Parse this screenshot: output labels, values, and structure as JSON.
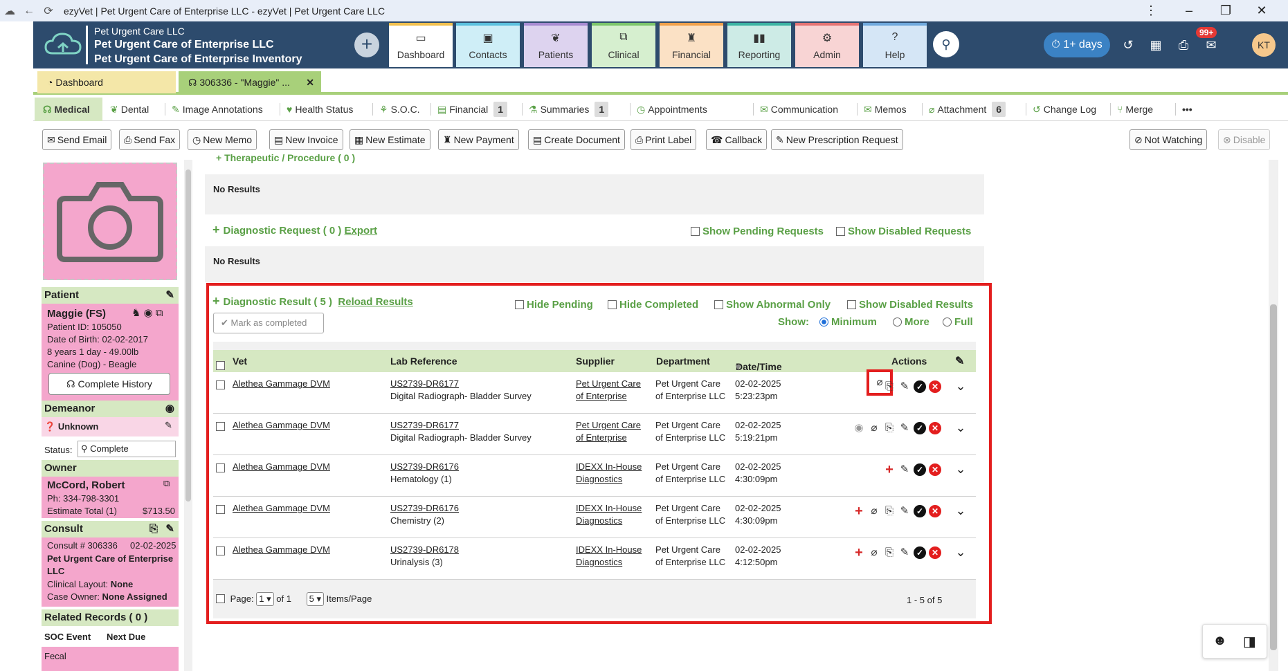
{
  "window": {
    "title": "ezyVet | Pet Urgent Care of Enterprise LLC - ezyVet | Pet Urgent Care LLC"
  },
  "header": {
    "org_line1": "Pet Urgent Care LLC",
    "org_line2": "Pet Urgent Care of Enterprise LLC",
    "org_line3": "Pet Urgent Care of Enterprise Inventory",
    "modules": [
      {
        "label": "Dashboard",
        "color": "#f2c04e",
        "bg": "#ffffff"
      },
      {
        "label": "Contacts",
        "color": "#5bc0de",
        "bg": "#cfeef7"
      },
      {
        "label": "Patients",
        "color": "#a78bd1",
        "bg": "#ddd3ef"
      },
      {
        "label": "Clinical",
        "color": "#7cc56b",
        "bg": "#d6efcf"
      },
      {
        "label": "Financial",
        "color": "#f0a04b",
        "bg": "#fbe1c5"
      },
      {
        "label": "Reporting",
        "color": "#3bb3a3",
        "bg": "#cdebe6"
      },
      {
        "label": "Admin",
        "color": "#e57373",
        "bg": "#f8d4d4"
      },
      {
        "label": "Help",
        "color": "#6fa8dc",
        "bg": "#d5e6f6"
      }
    ],
    "timer": "1+ days",
    "notifications_badge": "99+",
    "user_initials": "KT"
  },
  "tabs": {
    "dashboard": "Dashboard",
    "record": "306336 - \"Maggie\" ..."
  },
  "subnav": {
    "medical": "Medical",
    "dental": "Dental",
    "image_annotations": "Image Annotations",
    "health_status": "Health Status",
    "soc": "S.O.C.",
    "financial": "Financial",
    "financial_count": "1",
    "summaries": "Summaries",
    "summaries_count": "1",
    "appointments": "Appointments",
    "communication": "Communication",
    "memos": "Memos",
    "attachment": "Attachment",
    "attachment_count": "6",
    "change_log": "Change Log",
    "merge": "Merge",
    "more": "•••"
  },
  "toolbar": {
    "send_email": "Send Email",
    "send_fax": "Send Fax",
    "new_memo": "New Memo",
    "new_invoice": "New Invoice",
    "new_estimate": "New Estimate",
    "new_payment": "New Payment",
    "create_document": "Create Document",
    "print_label": "Print Label",
    "callback": "Callback",
    "new_prescription_request": "New Prescription Request",
    "not_watching": "Not Watching",
    "disable": "Disable"
  },
  "patient": {
    "section": "Patient",
    "name": "Maggie (FS)",
    "id": "Patient ID: 105050",
    "dob": "Date of Birth: 02-02-2017",
    "age_weight": "8 years 1 day - 49.00lb",
    "species": "Canine (Dog) - Beagle",
    "complete_history": "Complete History",
    "demeanor_section": "Demeanor",
    "demeanor": "Unknown",
    "status_label": "Status:",
    "status_value": "Complete",
    "owner_section": "Owner",
    "owner_name": "McCord, Robert",
    "owner_phone": "Ph: 334-798-3301",
    "estimate_label": "Estimate Total (1)",
    "estimate_value": "$713.50",
    "consult_section": "Consult",
    "consult_number": "Consult # 306336",
    "consult_date": "02-02-2025",
    "consult_clinic": "Pet Urgent Care of Enterprise LLC",
    "clinical_layout_label": "Clinical Layout:",
    "clinical_layout_value": "None",
    "case_owner_label": "Case Owner:",
    "case_owner_value": "None Assigned",
    "related_records": "Related Records ( 0 )",
    "soc_event": "SOC Event",
    "next_due": "Next Due",
    "fecal": "Fecal"
  },
  "main": {
    "therapeutic_header": "Therapeutic / Procedure ( 0 )",
    "no_results_1": "No Results",
    "diag_request_title": "Diagnostic Request ( 0 )",
    "diag_request_export": "Export",
    "show_pending_requests": "Show Pending Requests",
    "show_disabled_requests": "Show Disabled Requests",
    "no_results_2": "No Results",
    "diag_result_title": "Diagnostic Result ( 5 )",
    "reload_results": "Reload Results",
    "hide_pending": "Hide Pending",
    "hide_completed": "Hide Completed",
    "show_abnormal_only": "Show Abnormal Only",
    "show_disabled_results": "Show Disabled Results",
    "show_label": "Show:",
    "show_minimum": "Minimum",
    "show_more": "More",
    "show_full": "Full",
    "mark_as_completed": "Mark as completed",
    "columns": {
      "vet": "Vet",
      "lab_reference": "Lab Reference",
      "supplier": "Supplier",
      "department": "Department",
      "datetime": "Date/Time",
      "actions": "Actions"
    },
    "rows": [
      {
        "vet": "Alethea Gammage DVM",
        "lab_ref": "US2739-DR6177",
        "test": "Digital Radiograph- Bladder Survey",
        "supplier1": "Pet Urgent Care",
        "supplier2": "of Enterprise",
        "dept1": "Pet Urgent Care",
        "dept2": "of Enterprise LLC",
        "date": "02-02-2025",
        "time": "5:23:23pm"
      },
      {
        "vet": "Alethea Gammage DVM",
        "lab_ref": "US2739-DR6177",
        "test": "Digital Radiograph- Bladder Survey",
        "supplier1": "Pet Urgent Care",
        "supplier2": "of Enterprise",
        "dept1": "Pet Urgent Care",
        "dept2": "of Enterprise LLC",
        "date": "02-02-2025",
        "time": "5:19:21pm"
      },
      {
        "vet": "Alethea Gammage DVM",
        "lab_ref": "US2739-DR6176",
        "test": "Hematology (1)",
        "supplier1": "IDEXX In-House",
        "supplier2": "Diagnostics",
        "dept1": "Pet Urgent Care",
        "dept2": "of Enterprise LLC",
        "date": "02-02-2025",
        "time": "4:30:09pm"
      },
      {
        "vet": "Alethea Gammage DVM",
        "lab_ref": "US2739-DR6176",
        "test": "Chemistry (2)",
        "supplier1": "IDEXX In-House",
        "supplier2": "Diagnostics",
        "dept1": "Pet Urgent Care",
        "dept2": "of Enterprise LLC",
        "date": "02-02-2025",
        "time": "4:30:09pm"
      },
      {
        "vet": "Alethea Gammage DVM",
        "lab_ref": "US2739-DR6178",
        "test": "Urinalysis (3)",
        "supplier1": "IDEXX In-House",
        "supplier2": "Diagnostics",
        "dept1": "Pet Urgent Care",
        "dept2": "of Enterprise LLC",
        "date": "02-02-2025",
        "time": "4:12:50pm"
      }
    ],
    "page_label": "Page:",
    "page_value": "1",
    "of_total": "of 1",
    "items_per_page_value": "5",
    "items_per_page_label": "Items/Page",
    "range": "1 - 5 of 5"
  },
  "colors": {
    "header_bg": "#2d4b6d",
    "green_accent": "#5aa046",
    "section_green": "#d6e8c2",
    "patient_pink": "#f4a6cc",
    "highlight_red": "#e31e1e"
  }
}
